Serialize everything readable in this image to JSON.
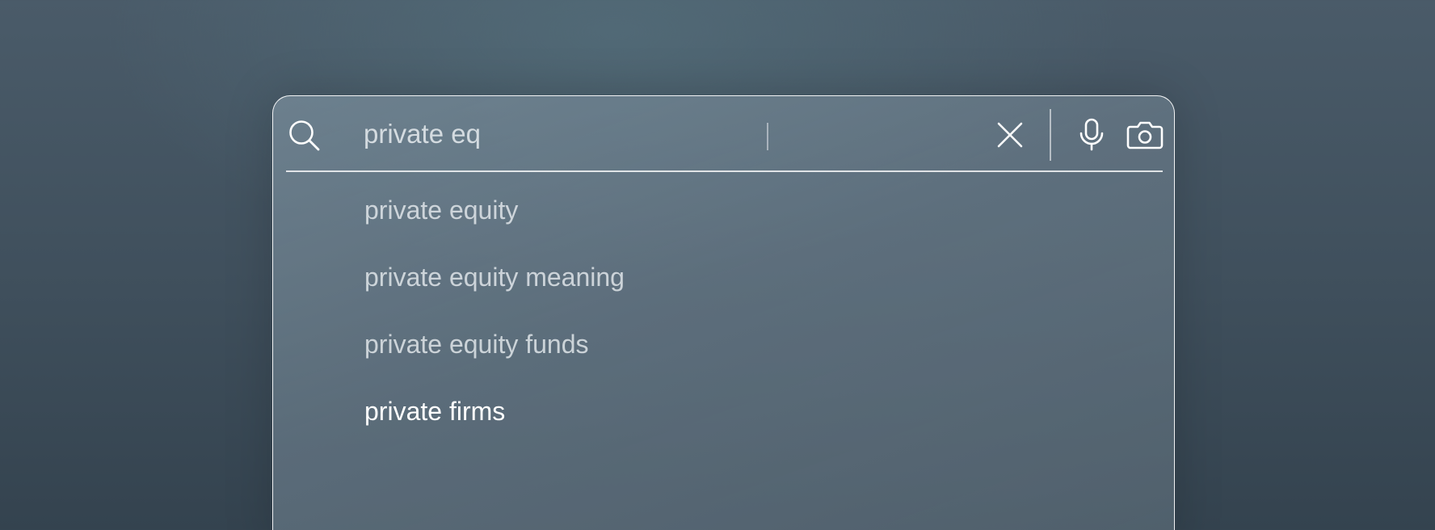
{
  "search": {
    "query": "private eq",
    "placeholder": ""
  },
  "icons": {
    "search": "search-icon",
    "clear": "close-icon",
    "voice": "microphone-icon",
    "image": "camera-icon"
  },
  "suggestions": [
    "private equity",
    "private equity meaning",
    "private equity funds",
    "private firms"
  ],
  "colors": {
    "text_muted": "#e4e9ed",
    "text_active": "#ffffff",
    "border": "#ffffff"
  }
}
